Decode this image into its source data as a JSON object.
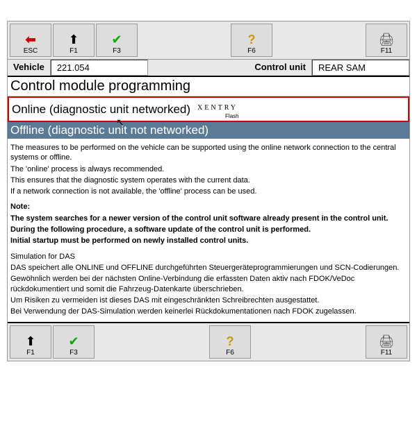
{
  "toolbar_top": {
    "esc": "ESC",
    "f1": "F1",
    "f3": "F3",
    "f6": "F6",
    "f11": "F11"
  },
  "info": {
    "vehicle_label": "Vehicle",
    "vehicle_value": "221.054",
    "control_unit_label": "Control unit",
    "control_unit_value": "REAR SAM"
  },
  "heading": "Control module programming",
  "option_online": "Online (diagnostic unit networked)",
  "xentry": "XENTRY",
  "xentry_sub": "Flash",
  "option_offline": "Offline (diagnostic unit not networked)",
  "body": {
    "p1": "The measures to be performed on the vehicle can be supported using the online network connection to the central systems or offline.",
    "p2": "The 'online' process is always recommended.",
    "p3": "This ensures that the diagnostic system operates with the current data.",
    "p4": "If a network connection is not available, the 'offline' process can be used.",
    "note_label": "Note:",
    "note1": "The system searches for a newer version of the control unit software already present in the control unit.",
    "note2": "During the following procedure, a software update of the control unit is performed.",
    "note3": "Initial startup must be performed on newly installed control units.",
    "sim_label": "Simulation for DAS",
    "sim1": "DAS speichert alle ONLINE und OFFLINE durchgeführten Steuergeräteprogrammierungen und SCN-Codierungen.",
    "sim2": "Gewöhnlich werden bei der nächsten Online-Verbindung die erfassten Daten aktiv nach FDOK/VeDoc rückdokumentiert und somit die Fahrzeug-Datenkarte überschrieben.",
    "sim3": "Um Risiken zu vermeiden ist dieses DAS mit eingeschränkten Schreibrechten ausgestattet.",
    "sim4": "Bei Verwendung der DAS-Simulation werden keinerlei Rückdokumentationen nach FDOK zugelassen."
  },
  "toolbar_bottom": {
    "f1": "F1",
    "f3": "F3",
    "f6": "F6",
    "f11": "F11"
  }
}
